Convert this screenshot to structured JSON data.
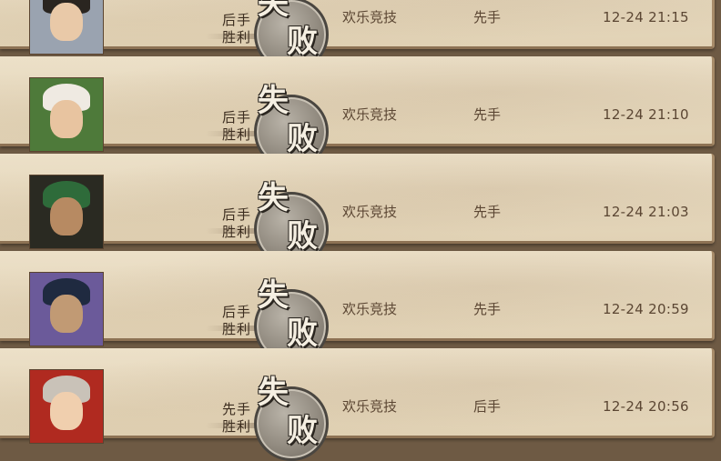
{
  "records": [
    {
      "turn": [
        "后手",
        "胜利"
      ],
      "result": [
        "失",
        "败"
      ],
      "mode": "欢乐竞技",
      "order": "先手",
      "time": "12-24 21:15",
      "avatar": {
        "face": "#e9c9a8",
        "hair": "#2a2520",
        "bg": "#9aa3b0"
      }
    },
    {
      "turn": [
        "后手",
        "胜利"
      ],
      "result": [
        "失",
        "败"
      ],
      "mode": "欢乐竞技",
      "order": "先手",
      "time": "12-24 21:10",
      "avatar": {
        "face": "#e8c4a0",
        "hair": "#efeae2",
        "bg": "#4e7a3a"
      }
    },
    {
      "turn": [
        "后手",
        "胜利"
      ],
      "result": [
        "失",
        "败"
      ],
      "mode": "欢乐竞技",
      "order": "先手",
      "time": "12-24 21:03",
      "avatar": {
        "face": "#b78a62",
        "hair": "#2e6b3a",
        "bg": "#2a2a22"
      }
    },
    {
      "turn": [
        "后手",
        "胜利"
      ],
      "result": [
        "失",
        "败"
      ],
      "mode": "欢乐竞技",
      "order": "先手",
      "time": "12-24 20:59",
      "avatar": {
        "face": "#c19a74",
        "hair": "#1f2a40",
        "bg": "#6b5a9a"
      }
    },
    {
      "turn": [
        "先手",
        "胜利"
      ],
      "result": [
        "失",
        "败"
      ],
      "mode": "欢乐竞技",
      "order": "后手",
      "time": "12-24 20:56",
      "avatar": {
        "face": "#f0cfae",
        "hair": "#c9c2b8",
        "bg": "#b02a20"
      }
    }
  ]
}
